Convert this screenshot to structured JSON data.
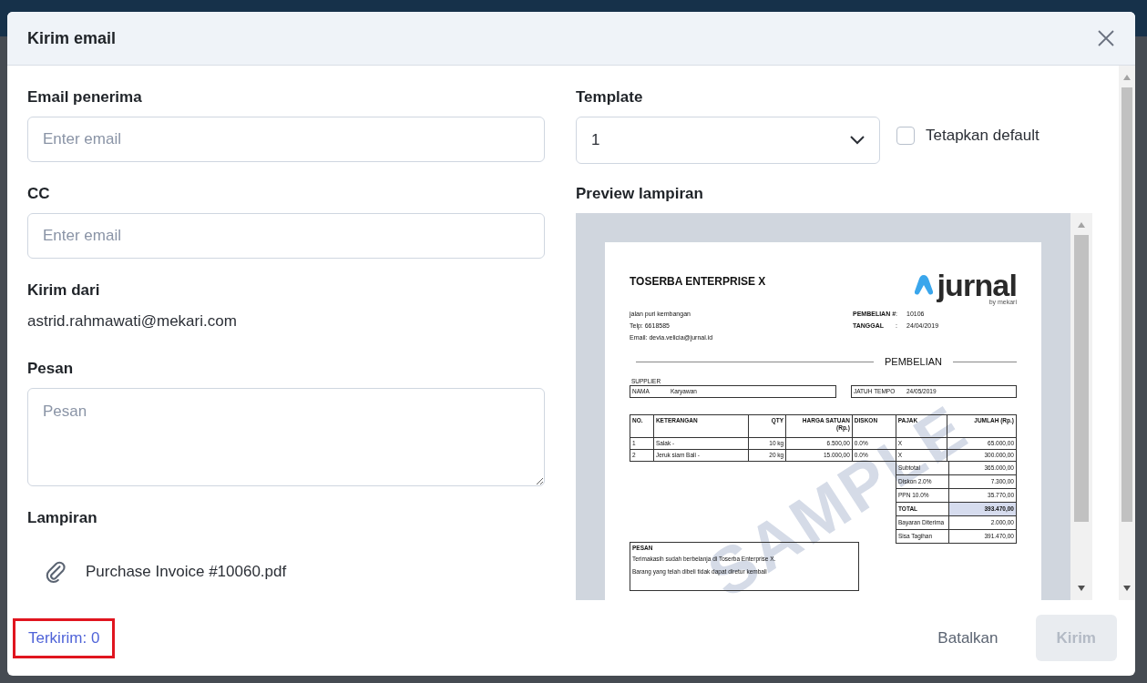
{
  "dialog": {
    "title": "Kirim email"
  },
  "recipient": {
    "label": "Email penerima",
    "placeholder": "Enter email"
  },
  "cc": {
    "label": "CC",
    "placeholder": "Enter email"
  },
  "sender": {
    "label": "Kirim dari",
    "value": "astrid.rahmawati@mekari.com"
  },
  "message": {
    "label": "Pesan",
    "placeholder": "Pesan"
  },
  "attachments": {
    "label": "Lampiran",
    "files": [
      "Purchase Invoice #10060.pdf"
    ]
  },
  "template": {
    "label": "Template",
    "value": "1",
    "set_default": {
      "label": "Tetapkan default",
      "checked": false
    }
  },
  "preview": {
    "label": "Preview lampiran",
    "document": {
      "company": "TOSERBA ENTERPRISE X",
      "logo": {
        "word": "jurnal",
        "tagline": "by mekari"
      },
      "address_lines": [
        "jalan puri kembangan",
        "Telp: 6618585",
        "Email: devia.velicia@jurnal.id"
      ],
      "meta": [
        {
          "label": "PEMBELIAN #",
          "separator": ":",
          "value": "10106"
        },
        {
          "label": "TANGGAL",
          "separator": ":",
          "value": "24/04/2019"
        }
      ],
      "heading": "PEMBELIAN",
      "supplier_label": "SUPPLIER",
      "supplier": {
        "label": "NAMA",
        "value": "Karyawan"
      },
      "due": {
        "label": "JATUH TEMPO",
        "value": "24/05/2019"
      },
      "columns": [
        "NO.",
        "KETERANGAN",
        "QTY",
        "HARGA SATUAN (Rp.)",
        "DISKON",
        "PAJAK",
        "JUMLAH (Rp.)"
      ],
      "rows": [
        [
          "1",
          "Salak -",
          "10 kg",
          "6.500,00",
          "0.0%",
          "X",
          "65.000,00"
        ],
        [
          "2",
          "Jeruk siam Bali -",
          "20 kg",
          "15.000,00",
          "0.0%",
          "X",
          "300.000,00"
        ]
      ],
      "summary": [
        {
          "label": "Subtotal",
          "value": "365.000,00",
          "highlighted": false
        },
        {
          "label": "Diskon 2.0%",
          "value": "7.300,00",
          "highlighted": false
        },
        {
          "label": "PPN 10.0%",
          "value": "35.770,00",
          "highlighted": false
        },
        {
          "label": "TOTAL",
          "value": "393.470,00",
          "highlighted": true
        },
        {
          "label": "Bayaran Diterima",
          "value": "2.000,00",
          "highlighted": false
        },
        {
          "label": "Sisa Tagihan",
          "value": "391.470,00",
          "highlighted": false
        }
      ],
      "note": {
        "title": "PESAN",
        "lines": [
          "Terimakasih sudah berbelanja di Toserba Enterprise X.",
          "Barang yang telah dibeli tidak dapat diretur kembali"
        ]
      },
      "watermark": "SAMPLE"
    }
  },
  "footer": {
    "sent_count": {
      "text": "Terkirim: 0",
      "highlighted": true
    },
    "buttons": [
      {
        "label": "Batalkan",
        "kind": "text",
        "disabled": false
      },
      {
        "label": "Kirim",
        "kind": "primary",
        "disabled": true
      }
    ]
  }
}
